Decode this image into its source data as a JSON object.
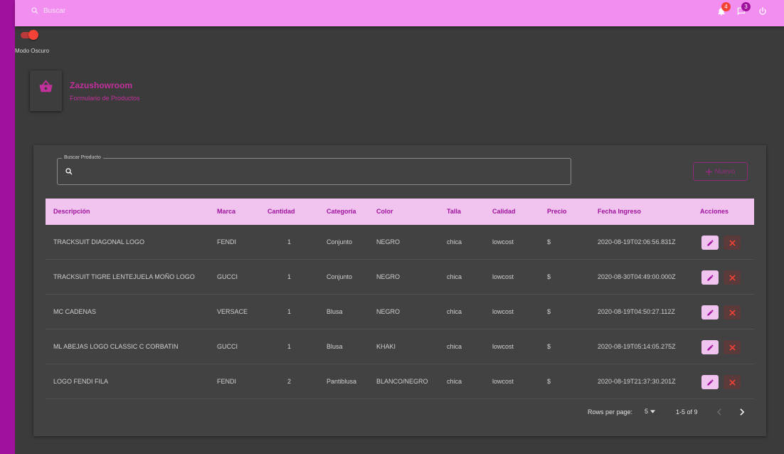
{
  "topbar": {
    "search_placeholder": "Buscar",
    "notifications_count": "4",
    "messages_count": "3",
    "colors": {
      "bar": "#f28ef0",
      "notif_badge": "#f44336",
      "msg_badge": "#a0129e"
    }
  },
  "dark_mode": {
    "label": "Modo Oscuro",
    "enabled": true
  },
  "header": {
    "title": "Zazushowroom",
    "subtitle": "Formulario de Productos",
    "icon": "shopping-basket-icon"
  },
  "search": {
    "legend": "Buscar Producto",
    "value": ""
  },
  "new_button": {
    "label": "Nuevo"
  },
  "table": {
    "columns": [
      "Descripción",
      "Marca",
      "Cantidad",
      "Categoría",
      "Color",
      "Talla",
      "Calidad",
      "Precio",
      "Fecha Ingreso",
      "Acciones"
    ],
    "rows": [
      {
        "descripcion": "TRACKSUIT DIAGONAL LOGO",
        "marca": "FENDI",
        "cantidad": "1",
        "categoria": "Conjunto",
        "color": "NEGRO",
        "talla": "chica",
        "calidad": "lowcost",
        "precio": "$",
        "fecha": "2020-08-19T02:06:56.831Z"
      },
      {
        "descripcion": "TRACKSUIT TIGRE LENTEJUELA MOÑO LOGO",
        "marca": "GUCCI",
        "cantidad": "1",
        "categoria": "Conjunto",
        "color": "NEGRO",
        "talla": "chica",
        "calidad": "lowcost",
        "precio": "$",
        "fecha": "2020-08-30T04:49:00.000Z"
      },
      {
        "descripcion": "MC CADENAS",
        "marca": "VERSACE",
        "cantidad": "1",
        "categoria": "Blusa",
        "color": "NEGRO",
        "talla": "chica",
        "calidad": "lowcost",
        "precio": "$",
        "fecha": "2020-08-19T04:50:27.112Z"
      },
      {
        "descripcion": "ML ABEJAS LOGO CLASSIC C CORBATIN",
        "marca": "GUCCI",
        "cantidad": "1",
        "categoria": "Blusa",
        "color": "KHAKI",
        "talla": "chica",
        "calidad": "lowcost",
        "precio": "$",
        "fecha": "2020-08-19T05:14:05.275Z"
      },
      {
        "descripcion": "LOGO FENDI FILA",
        "marca": "FENDI",
        "cantidad": "2",
        "categoria": "Pantiblusa",
        "color": "BLANCO/NEGRO",
        "talla": "chica",
        "calidad": "lowcost",
        "precio": "$",
        "fecha": "2020-08-19T21:37:30.201Z"
      }
    ]
  },
  "pagination": {
    "rows_label": "Rows per page:",
    "rows_value": "5",
    "range": "1-5 of 9"
  }
}
